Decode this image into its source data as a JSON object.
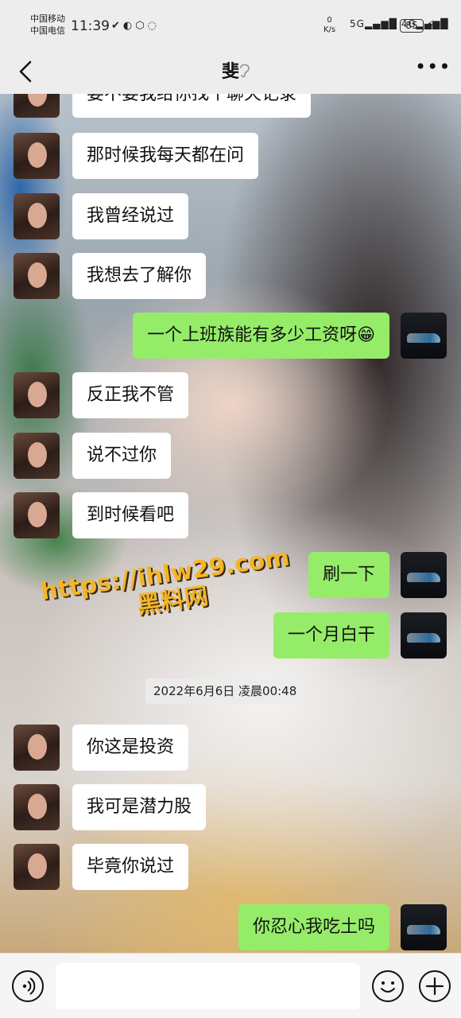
{
  "status_bar": {
    "carrier_1": "中国移动",
    "carrier_2": "中国电信",
    "time": "11:39",
    "net_speed_value": "0",
    "net_speed_unit": "K/s",
    "signal_1": "5G",
    "signal_2": "4G",
    "battery": "85"
  },
  "header": {
    "title": "斐"
  },
  "watermark": {
    "line1": "https://ihlw29.com",
    "line2": "黑料网"
  },
  "messages": [
    {
      "from": "her",
      "text": "要不要我给你找个聊天记录"
    },
    {
      "from": "her",
      "text": "那时候我每天都在问"
    },
    {
      "from": "her",
      "text": "我曾经说过"
    },
    {
      "from": "her",
      "text": "我想去了解你"
    },
    {
      "from": "me",
      "text": "一个上班族能有多少工资呀😁"
    },
    {
      "from": "her",
      "text": "反正我不管"
    },
    {
      "from": "her",
      "text": "说不过你"
    },
    {
      "from": "her",
      "text": "到时候看吧"
    },
    {
      "from": "me",
      "text": "刷一下"
    },
    {
      "from": "me",
      "text": "一个月白干"
    },
    {
      "from": "her",
      "text": "你这是投资"
    },
    {
      "from": "her",
      "text": "我可是潜力股"
    },
    {
      "from": "her",
      "text": "毕竟你说过"
    },
    {
      "from": "me",
      "text": "你忍心我吃土吗"
    }
  ],
  "timestamp": "2022年6月6日 凌晨00:48",
  "colors": {
    "background": "#ededed",
    "my_bubble": "#95ec69",
    "her_bubble": "#ffffff",
    "watermark": "#f4b52a"
  },
  "icons": {
    "back": "chevron-left-icon",
    "ear": "ear-icon",
    "more": "more-icon",
    "voice": "voice-icon",
    "emoji": "emoji-icon",
    "plus": "plus-icon"
  }
}
